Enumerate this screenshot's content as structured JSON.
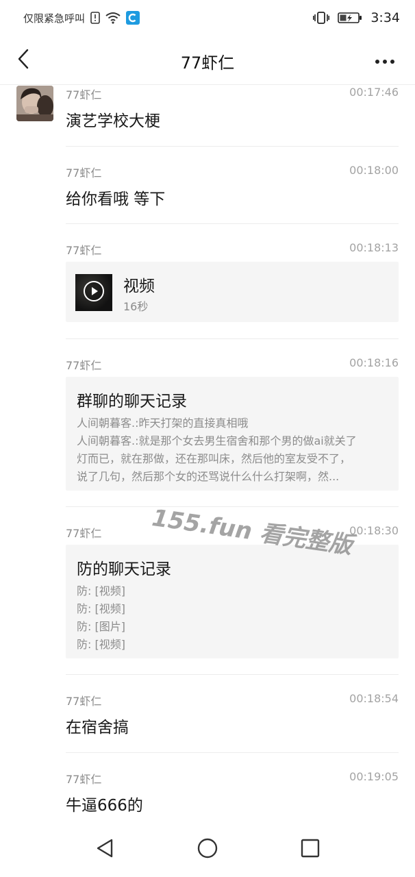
{
  "status_bar": {
    "carrier_text": "仅限紧急呼叫",
    "time": "3:34"
  },
  "header": {
    "title": "77虾仁"
  },
  "messages": [
    {
      "sender": "77虾仁",
      "time": "00:17:46",
      "text": "演艺学校大梗"
    },
    {
      "sender": "77虾仁",
      "time": "00:18:00",
      "text": "给你看哦 等下"
    },
    {
      "sender": "77虾仁",
      "time": "00:18:13",
      "video": {
        "title": "视频",
        "duration": "16秒"
      }
    },
    {
      "sender": "77虾仁",
      "time": "00:18:16",
      "record": {
        "title": "群聊的聊天记录",
        "lines": [
          "人间朝暮客.:昨天打架的直接真相哦",
          "人间朝暮客.:就是那个女去男生宿舍和那个男的做ai就关了",
          "灯而已，就在那做，还在那叫床，然后他的室友受不了，",
          "说了几句，然后那个女的还骂说什么什么打架啊，然..."
        ]
      }
    },
    {
      "sender": "77虾仁",
      "time": "00:18:30",
      "record": {
        "title": "防的聊天记录",
        "lines": [
          "防: [视频]",
          "防: [视频]",
          "防: [图片]",
          "防: [视频]"
        ]
      }
    },
    {
      "sender": "77虾仁",
      "time": "00:18:54",
      "text": "在宿舍搞"
    },
    {
      "sender": "77虾仁",
      "time": "00:19:05",
      "text": "牛逼666的"
    }
  ],
  "watermark": "155.fun 看完整版",
  "icons": {
    "back": "chevron-left-icon",
    "more": "more-dots-icon",
    "nav_back": "triangle-back-icon",
    "nav_home": "circle-home-icon",
    "nav_recent": "square-recent-icon"
  }
}
